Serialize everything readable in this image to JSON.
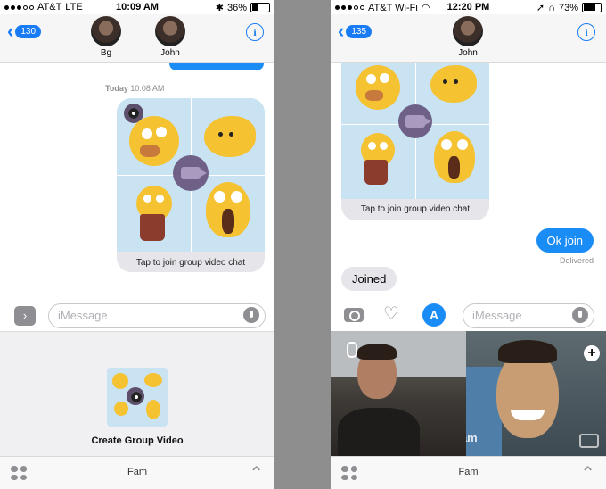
{
  "left": {
    "status": {
      "carrier": "AT&T",
      "network": "LTE",
      "time": "10:09 AM",
      "battery": "36%",
      "battery_fraction": 0.36
    },
    "nav": {
      "back_count": "130",
      "contacts": [
        {
          "name": "Bg"
        },
        {
          "name": "John"
        }
      ]
    },
    "timestamp": {
      "day": "Today",
      "time": "10:08 AM"
    },
    "card_caption": "Tap to join group video chat",
    "input_placeholder": "iMessage",
    "tray_label": "Create Group Video",
    "bottom_label": "Fam"
  },
  "right": {
    "status": {
      "carrier": "AT&T Wi-Fi",
      "time": "12:20 PM",
      "battery": "73%",
      "battery_fraction": 0.73
    },
    "nav": {
      "back_count": "135",
      "contacts": [
        {
          "name": "John"
        }
      ]
    },
    "card_caption": "Tap to join group video chat",
    "sent_message": "Ok join",
    "delivered": "Delivered",
    "received_message": "Joined",
    "input_placeholder": "iMessage",
    "video_label": "Fam",
    "bottom_label": "Fam"
  },
  "colors": {
    "ios_blue": "#1a8cf5",
    "bubble_gray": "#e5e5ea",
    "tile_blue": "#c9e3f3",
    "emoji_yellow": "#f5c232",
    "cam_purple": "#6e6087"
  },
  "icons": [
    "chevron-left",
    "info",
    "camera",
    "video-camera",
    "heart-digital-touch",
    "app-store",
    "microphone",
    "apps-grid",
    "chevron-up",
    "plus"
  ]
}
